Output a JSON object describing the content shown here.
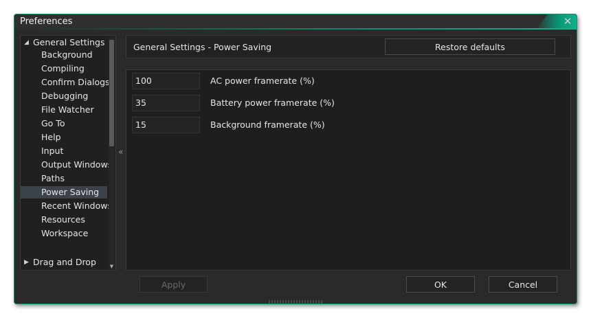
{
  "window": {
    "title": "Preferences",
    "close_icon": "close-icon",
    "accent_color": "#0fae88"
  },
  "sidebar": {
    "root": {
      "label": "General Settings",
      "icon": "expanded-triangle-icon"
    },
    "items": [
      {
        "label": "Background"
      },
      {
        "label": "Compiling"
      },
      {
        "label": "Confirm Dialogs"
      },
      {
        "label": "Debugging"
      },
      {
        "label": "File Watcher"
      },
      {
        "label": "Go To"
      },
      {
        "label": "Help"
      },
      {
        "label": "Input"
      },
      {
        "label": "Output Windows"
      },
      {
        "label": "Paths"
      },
      {
        "label": "Power Saving",
        "selected": true
      },
      {
        "label": "Recent Windows"
      },
      {
        "label": "Resources"
      },
      {
        "label": "Workspace"
      }
    ],
    "collapsed_root": {
      "label": "Drag and Drop",
      "icon": "collapsed-triangle-icon"
    },
    "collapse_icon": "«"
  },
  "header": {
    "title": "General Settings - Power Saving",
    "restore_label": "Restore defaults"
  },
  "settings": [
    {
      "value": "100",
      "label": "AC power framerate (%)"
    },
    {
      "value": "35",
      "label": "Battery power framerate (%)"
    },
    {
      "value": "15",
      "label": "Background framerate (%)"
    }
  ],
  "footer": {
    "apply_label": "Apply",
    "ok_label": "OK",
    "cancel_label": "Cancel"
  }
}
